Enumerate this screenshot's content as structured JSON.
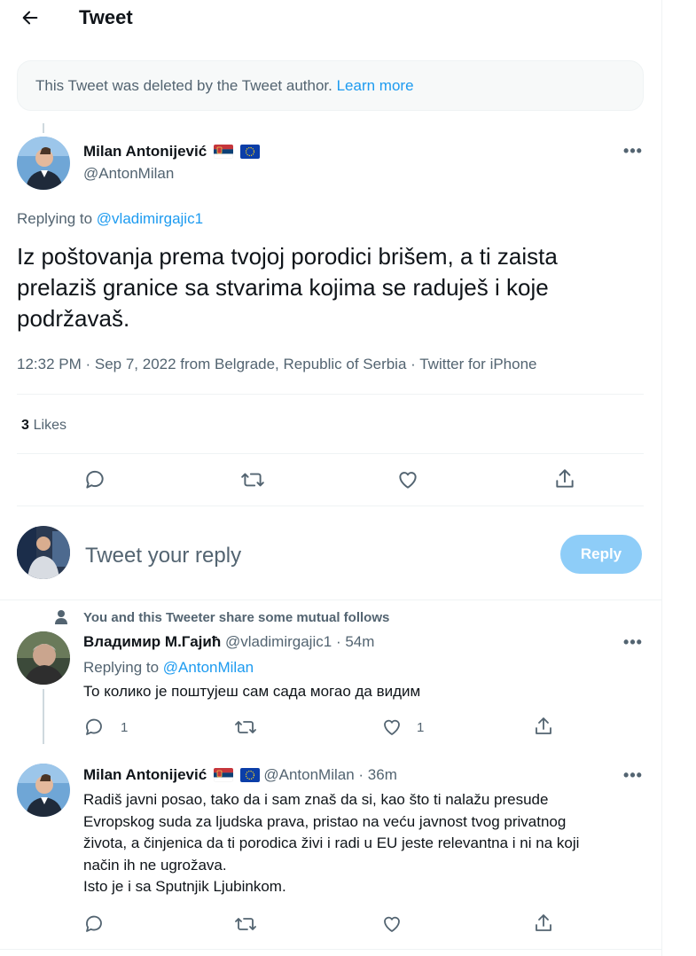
{
  "header": {
    "title": "Tweet"
  },
  "deleted_notice": {
    "text": "This Tweet was deleted by the Tweet author.",
    "link": "Learn more"
  },
  "main_tweet": {
    "name": "Milan Antonijević",
    "handle": "@AntonMilan",
    "replying_label": "Replying to",
    "replying_to": "@vladimirgajic1",
    "text": "Iz poštovanja prema tvojoj porodici brišem, a ti zaista prelaziš granice sa stvarima kojima se raduješ i koje podržavaš.",
    "meta": "12:32 PM · Sep 7, 2022 from Belgrade, Republic of Serbia · Twitter for iPhone",
    "likes_count": "3",
    "likes_label": "Likes"
  },
  "reply_box": {
    "placeholder": "Tweet your reply",
    "button": "Reply"
  },
  "replies": [
    {
      "context": "You and this Tweeter share some mutual follows",
      "name": "Владимир М.Гајић",
      "handle": "@vladimirgajic1",
      "time": "· 54m",
      "replying_label": "Replying to",
      "replying_to": "@AntonMilan",
      "text": "То колико је поштујеш сам сада могао да видим",
      "reply_count": "1",
      "like_count": "1"
    },
    {
      "name": "Milan Antonijević",
      "handle": "@AntonMilan",
      "time": "· 36m",
      "text_lines": [
        "Radiš javni posao, tako da i sam znaš da si, kao što ti nalažu presude",
        "Evropskog suda za ljudska prava, pristao na veću javnost tvog privatnog",
        "života, a činjenica da ti porodica živi i radi u EU jeste relevantna i ni na koji",
        "način ih ne ugrožava.",
        "Isto je i sa Sputnjik Ljubinkom."
      ]
    }
  ],
  "icons": {
    "back": "arrow-left-icon",
    "more": "more-horizontal-icon",
    "reply": "reply-bubble-icon",
    "retweet": "retweet-icon",
    "like": "heart-icon",
    "share": "share-icon",
    "person": "person-icon"
  },
  "colors": {
    "link": "#1d9bf0",
    "muted": "#536471",
    "reply_button": "#8ecdf8"
  }
}
